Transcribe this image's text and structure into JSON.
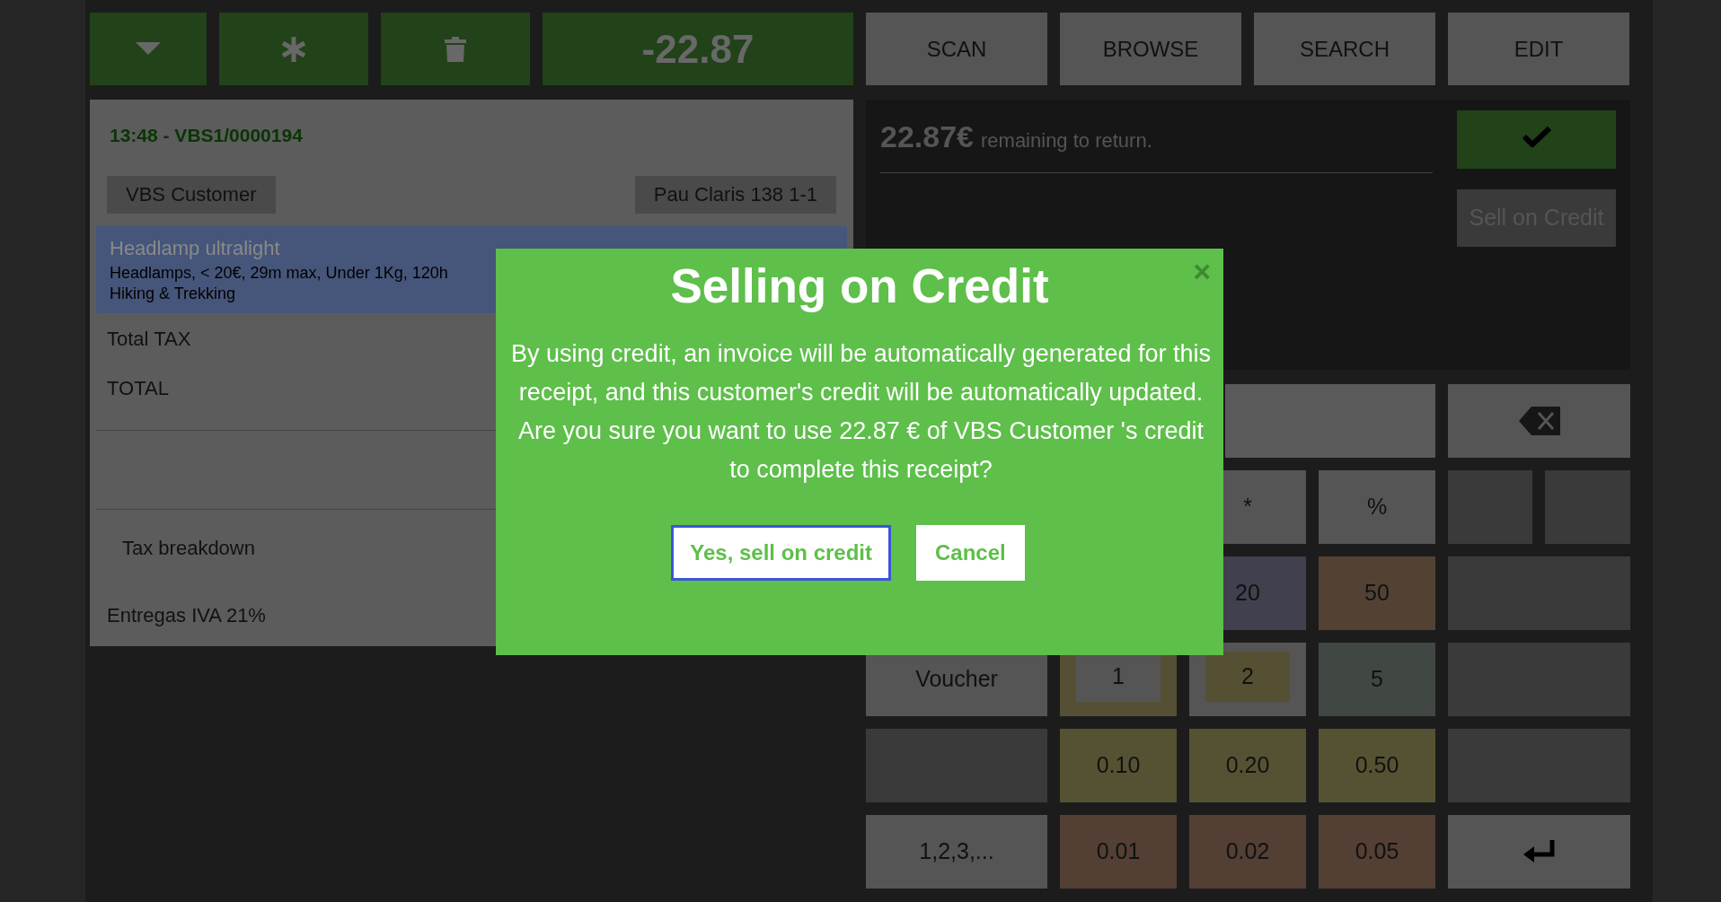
{
  "toolbar": {
    "total": "-22.87"
  },
  "nav_buttons": [
    {
      "label": "SCAN"
    },
    {
      "label": "BROWSE"
    },
    {
      "label": "SEARCH"
    },
    {
      "label": "EDIT"
    }
  ],
  "receipt": {
    "header": "13:48 - VBS1/0000194",
    "customer": "VBS Customer",
    "address": "Pau Claris 138 1-1",
    "lines": [
      {
        "name": "Headlamp ultralight",
        "details": "Headlamps, < 20€, 29m max, Under 1Kg, 120h",
        "category": "Hiking & Trekking",
        "selected": true
      }
    ],
    "totals": [
      "Total TAX",
      "TOTAL"
    ],
    "tax_breakdown_title": "Tax breakdown",
    "tax_rows": [
      "Entregas IVA 21%"
    ]
  },
  "payment": {
    "amount": "22.87€",
    "message": "remaining to return.",
    "sell_on_credit": "Sell on Credit"
  },
  "keypad": [
    {
      "keys": [
        {
          "kind": "field",
          "color": "#5a5a5a"
        },
        {
          "kind": "backspace",
          "color": "#555555"
        }
      ]
    },
    {
      "keys": [
        {
          "kind": "key",
          "label": "*",
          "color": "#555555"
        },
        {
          "kind": "key",
          "label": "%",
          "color": "#555555"
        },
        {
          "kind": "half",
          "color": "#3a3a3a"
        },
        {
          "kind": "half",
          "color": "#3a3a3a"
        }
      ]
    },
    {
      "keys": [
        {
          "kind": "key",
          "label": "20",
          "color": "#40404f"
        },
        {
          "kind": "key",
          "label": "50",
          "color": "#534233"
        },
        {
          "kind": "blank",
          "color": "#3a3a3a"
        }
      ]
    },
    {
      "keys": [
        {
          "kind": "key",
          "label": "Voucher",
          "color": "#555555"
        },
        {
          "kind": "key",
          "label": "1",
          "color": "#555555",
          "frame": {
            "color": "#555033"
          }
        },
        {
          "kind": "key",
          "label": "2",
          "color": "#555033",
          "frame": {
            "color": "#555555"
          }
        },
        {
          "kind": "key",
          "label": "5",
          "color": "#414743"
        },
        {
          "kind": "blank",
          "color": "#3a3a3a"
        }
      ]
    },
    {
      "keys": [
        {
          "kind": "blank",
          "color": "#3a3a3a"
        },
        {
          "kind": "key",
          "label": "0.10",
          "color": "#555233"
        },
        {
          "kind": "key",
          "label": "0.20",
          "color": "#555233"
        },
        {
          "kind": "key",
          "label": "0.50",
          "color": "#555233"
        },
        {
          "kind": "blank",
          "color": "#3a3a3a"
        }
      ]
    },
    {
      "keys": [
        {
          "kind": "key",
          "label": "1,2,3,...",
          "color": "#555555"
        },
        {
          "kind": "key",
          "label": "0.01",
          "color": "#533f33"
        },
        {
          "kind": "key",
          "label": "0.02",
          "color": "#533f33"
        },
        {
          "kind": "key",
          "label": "0.05",
          "color": "#533f33"
        },
        {
          "kind": "enter",
          "color": "#555555"
        }
      ]
    }
  ],
  "modal": {
    "title": "Selling on Credit",
    "close": "×",
    "body": "By using credit, an invoice will be automatically generated for this receipt, and this customer's credit will be automatically updated. Are you sure you want to use 22.87 € of VBS Customer 's credit to complete this receipt?",
    "buttons": [
      {
        "label": "Yes, sell on credit",
        "focused": true
      },
      {
        "label": "Cancel",
        "focused": false
      }
    ]
  }
}
